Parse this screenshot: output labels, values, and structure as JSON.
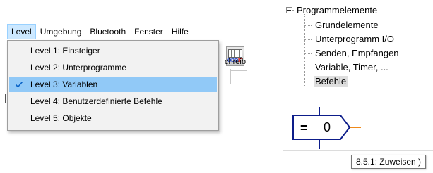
{
  "menubar": {
    "items": [
      "Level",
      "Umgebung",
      "Bluetooth",
      "Fenster",
      "Hilfe"
    ]
  },
  "level_menu": {
    "items": [
      {
        "label": "Level 1: Einsteiger",
        "checked": false
      },
      {
        "label": "Level 2: Unterprogramme",
        "checked": false
      },
      {
        "label": "Level 3: Variablen",
        "checked": true
      },
      {
        "label": "Level 4: Benutzerdefinierte Befehle",
        "checked": false
      },
      {
        "label": "Level 5: Objekte",
        "checked": false
      }
    ],
    "selected_color": "#91c9f7",
    "check_color": "#0a64c8"
  },
  "toolbar": {
    "icon_text_blue": "OBO",
    "icon_text_red": "IF",
    "icon_name": "robo-interface-icon"
  },
  "side_panel": {
    "partial_text": "chreib"
  },
  "tree": {
    "root": "Programmelemente",
    "children": [
      "Grundelemente",
      "Unterprogramm I/O",
      "Senden, Empfangen",
      "Variable, Timer, ...",
      "Befehle"
    ],
    "selected_index": 4
  },
  "block": {
    "operator": "=",
    "value": "0",
    "line_color": "#0d1d8a",
    "output_color": "#ef8a1b"
  },
  "tooltip": {
    "text": "8.5.1: Zuweisen )"
  }
}
